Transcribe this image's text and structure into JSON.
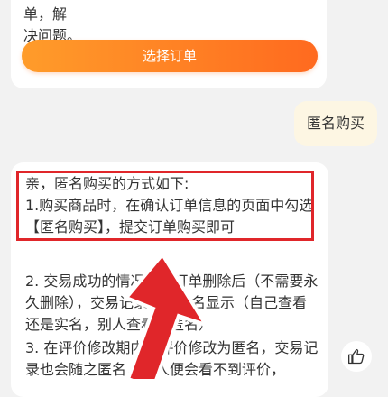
{
  "bot_top": {
    "lines": "亲，感谢您的耐心等待，小智可以帮您查看订单，解\n决问题。",
    "select_order_label": "选择订单"
  },
  "user_message": "匿名购买",
  "bot_reply": {
    "intro": "亲，匿名购买的方式如下:",
    "step1": "1.购买商品时，在确认订单信息的页面中勾选 【匿名购买】，提交订单购买即可",
    "step2": "2. 交易成功的情况下，订单删除后（不需要永久删除），交易记录将会匿名显示（自己查看还是实名，别人查看是匿名）",
    "step3": "3. 在评价修改期内，评价修改为匿名，交易记录也会随之匿名，别人便会看不到评价，"
  },
  "colors": {
    "accent_orange": "#ff7a22",
    "highlight_red": "#e0262a"
  },
  "icons": {
    "like": "thumbs-up-icon",
    "annotation": "red-arrow"
  }
}
